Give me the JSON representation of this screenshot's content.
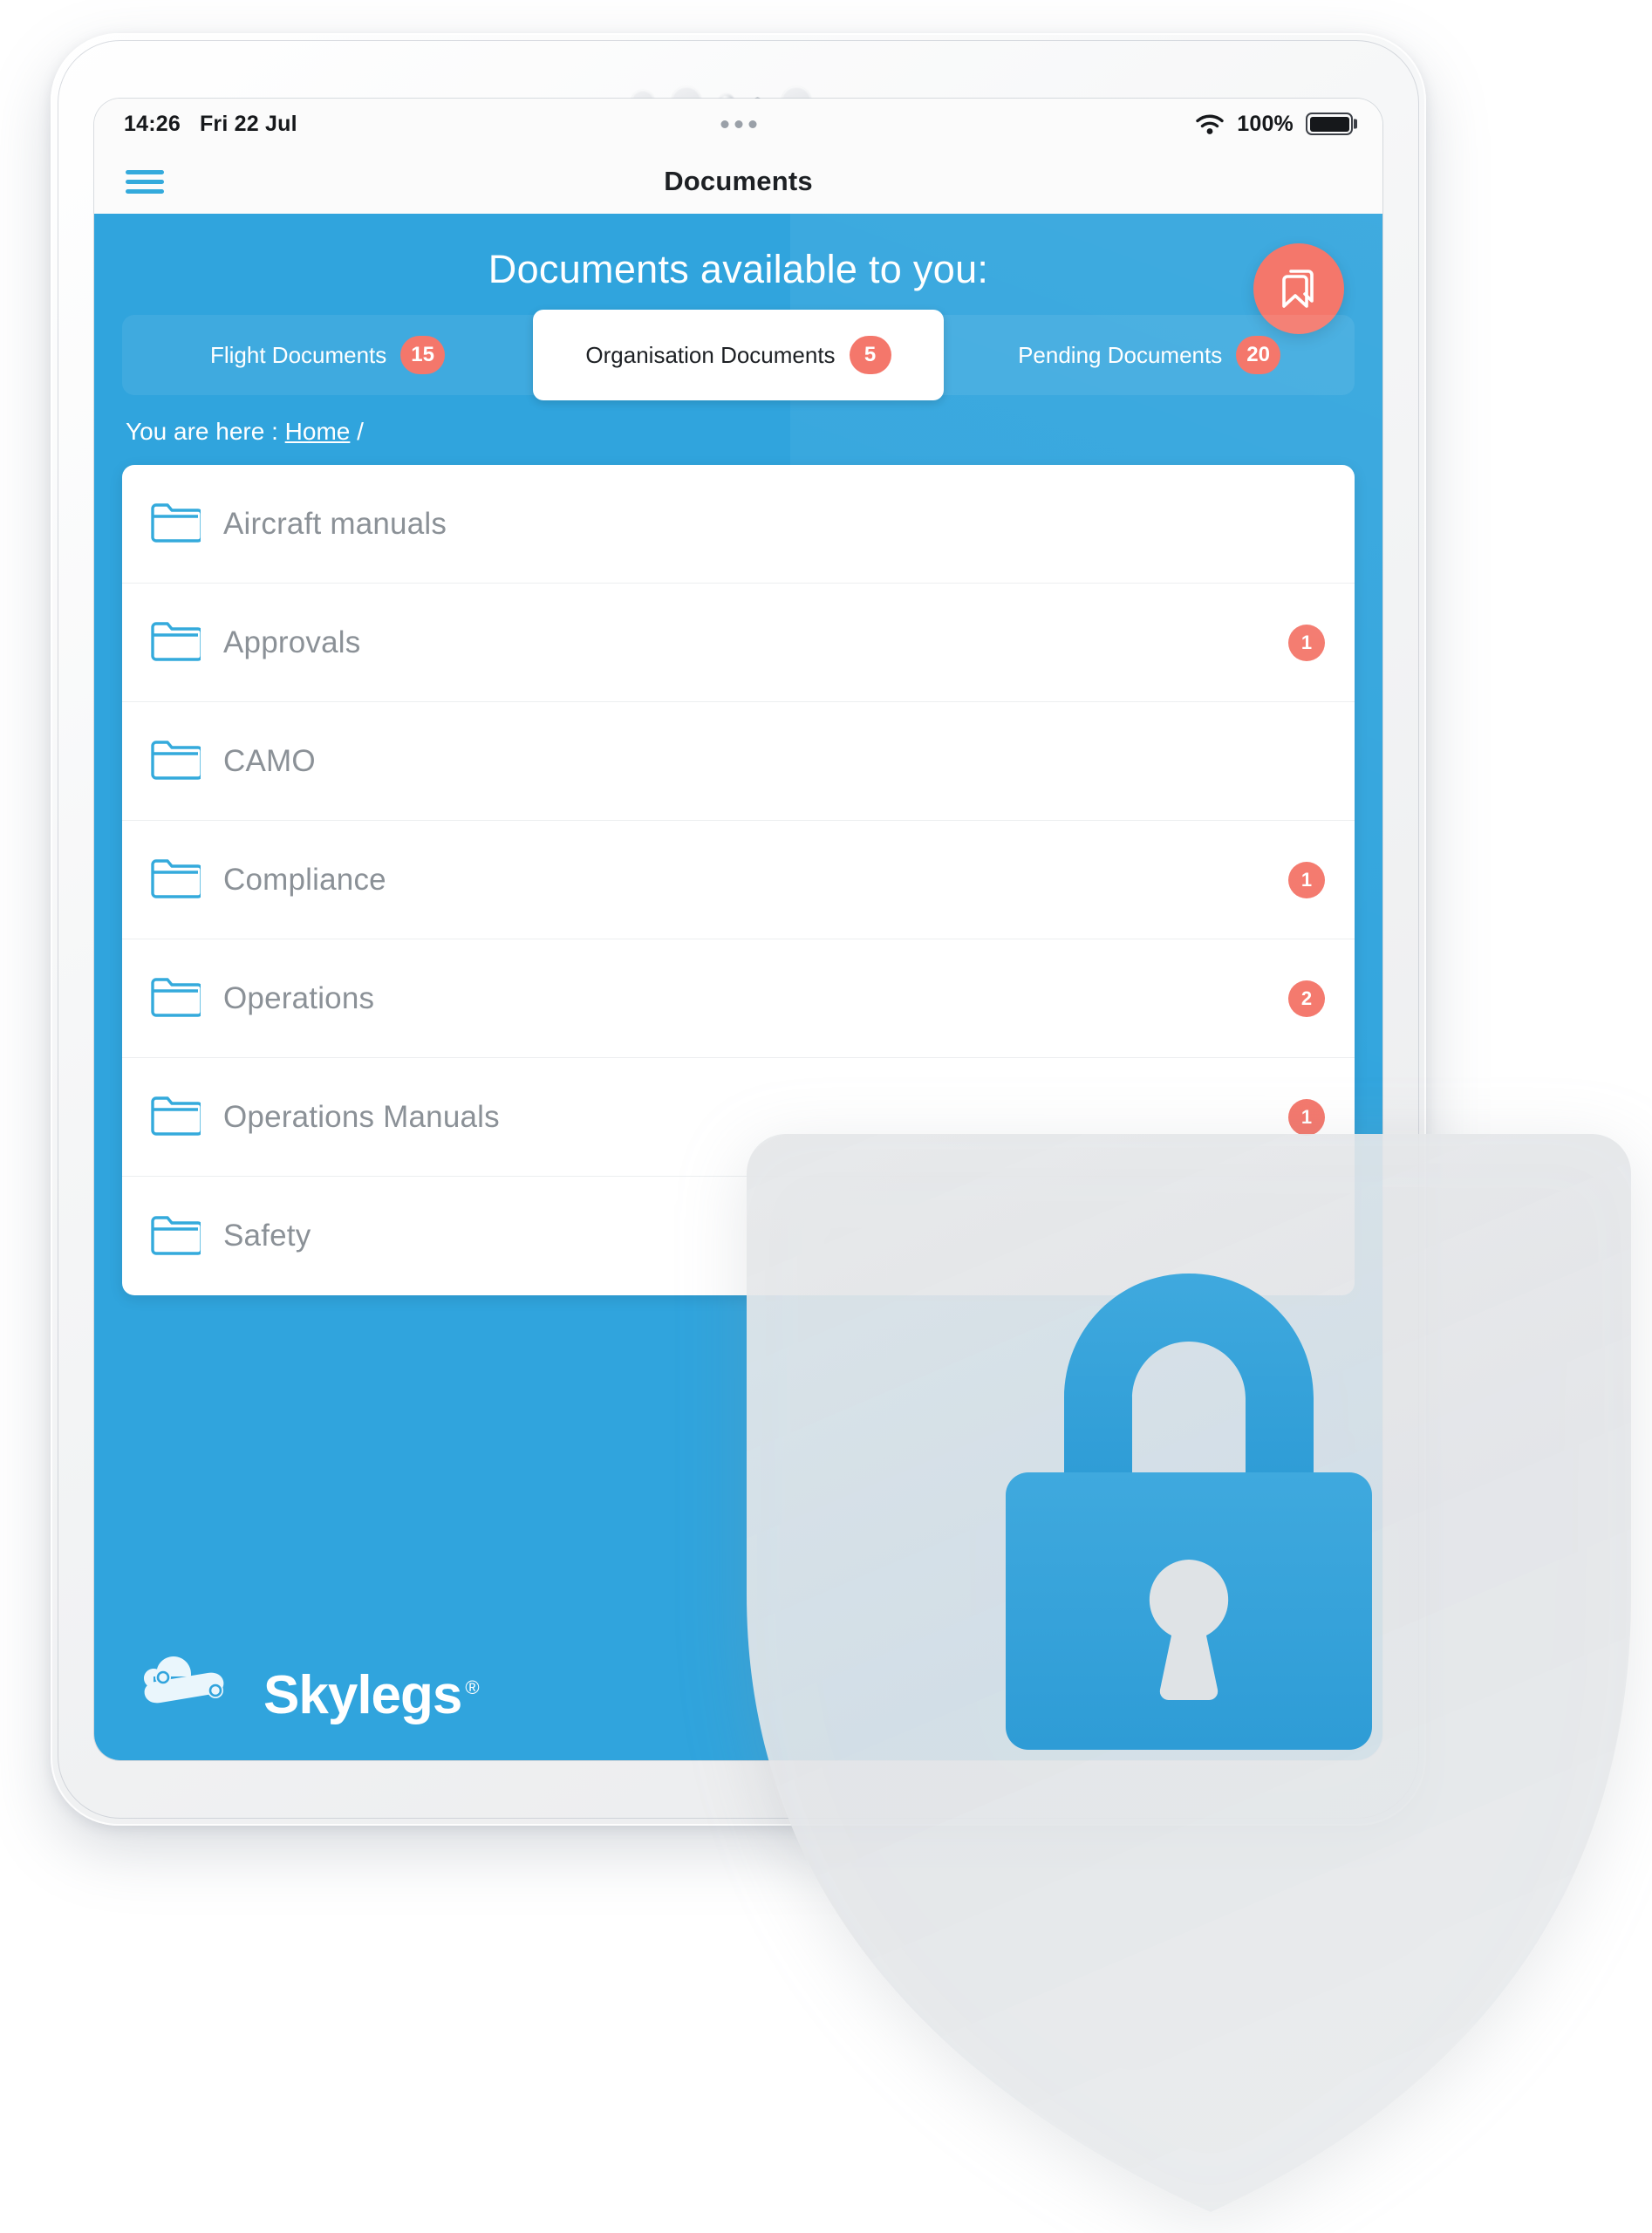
{
  "statusbar": {
    "time": "14:26",
    "date": "Fri 22 Jul",
    "battery_percent": "100%",
    "wifi_icon": "wifi-icon",
    "battery_icon": "battery-full-icon",
    "center_indicator": "three-dots-icon"
  },
  "navbar": {
    "menu_icon": "hamburger-menu-icon",
    "title": "Documents"
  },
  "hero": {
    "title": "Documents available to you:",
    "bookmark_icon": "bookmark-icon"
  },
  "tabs": [
    {
      "label": "Flight Documents",
      "count": "15",
      "active": false
    },
    {
      "label": "Organisation Documents",
      "count": "5",
      "active": true
    },
    {
      "label": "Pending Documents",
      "count": "20",
      "active": false
    }
  ],
  "breadcrumb": {
    "prefix": "You are here :",
    "home": "Home",
    "separator": "/"
  },
  "folders": [
    {
      "name": "Aircraft manuals",
      "count": "",
      "icon": "folder-icon"
    },
    {
      "name": "Approvals",
      "count": "1",
      "icon": "folder-icon"
    },
    {
      "name": "CAMO",
      "count": "",
      "icon": "folder-icon"
    },
    {
      "name": "Compliance",
      "count": "1",
      "icon": "folder-icon"
    },
    {
      "name": "Operations",
      "count": "2",
      "icon": "folder-icon"
    },
    {
      "name": "Operations Manuals",
      "count": "1",
      "icon": "folder-icon"
    },
    {
      "name": "Safety",
      "count": "",
      "icon": "folder-icon"
    }
  ],
  "branding": {
    "wordmark": "Skylegs",
    "registered": "®",
    "mark_icon": "skylegs-cloud-wing-logo-icon"
  },
  "overlay": {
    "shield_icon": "shield-icon",
    "lock_icon": "padlock-icon"
  },
  "colors": {
    "brand_blue": "#30a4dd",
    "accent_coral": "#f4776b",
    "folder_text": "#8b9197",
    "card_white": "#ffffff"
  }
}
